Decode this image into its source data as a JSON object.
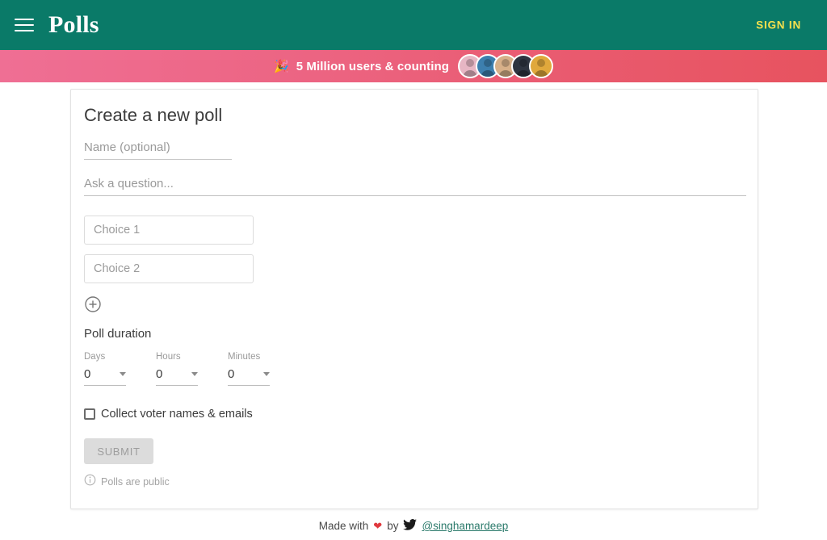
{
  "appbar": {
    "menu_icon": "hamburger-menu-icon",
    "brand": "Polls",
    "signin_label": "SIGN IN",
    "background_color": "#0a7a68",
    "signin_color": "#f4e04d"
  },
  "promo": {
    "emoji": "🎉",
    "text": "5 Million users & counting",
    "avatar_count": 5,
    "gradient_from": "#ef6f94",
    "gradient_to": "#e7535f"
  },
  "card": {
    "title": "Create a new poll",
    "name_field": {
      "value": "",
      "placeholder": "Name (optional)"
    },
    "question_field": {
      "value": "",
      "placeholder": "Ask a question..."
    },
    "choices": [
      {
        "value": "",
        "placeholder": "Choice 1"
      },
      {
        "value": "",
        "placeholder": "Choice 2"
      }
    ],
    "add_choice_icon": "plus-circle-icon",
    "duration": {
      "label": "Poll duration",
      "fields": [
        {
          "caption": "Days",
          "value": "0"
        },
        {
          "caption": "Hours",
          "value": "0"
        },
        {
          "caption": "Minutes",
          "value": "0"
        }
      ]
    },
    "collect_voters": {
      "label": "Collect voter names & emails",
      "checked": false
    },
    "submit_label": "SUBMIT",
    "submit_disabled": true,
    "public_note": {
      "icon": "info-circle-icon",
      "text": "Polls are public"
    }
  },
  "footer": {
    "made_with": "Made with",
    "heart": "❤",
    "by": "by",
    "twitter_icon": "twitter-bird-icon",
    "handle": "@singhamardeep"
  }
}
